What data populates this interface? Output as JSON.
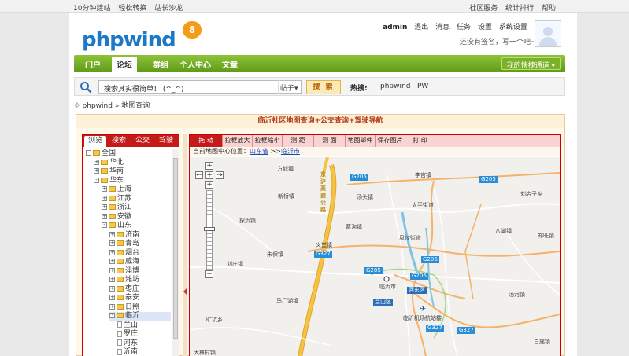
{
  "topbar": {
    "left_links": [
      "10分钟建站",
      "轻松转换",
      "站长沙龙"
    ],
    "right_links": [
      "社区服务",
      "统计排行",
      "帮助"
    ]
  },
  "logo": {
    "part1": "php",
    "part2": "wind",
    "version": "8"
  },
  "user": {
    "name": "admin",
    "links": [
      "退出",
      "消息",
      "任务",
      "设置",
      "系统设置"
    ],
    "signature": "还没有签名，写一个吧~"
  },
  "nav": {
    "items": [
      "门户",
      "论坛",
      "群组",
      "个人中心",
      "文章"
    ],
    "active_index": 1,
    "quick": "我的快捷通道"
  },
  "search": {
    "value": "搜索其实很简单！ (^_^)",
    "scope": "帖子",
    "button": "搜 索",
    "hot_label": "热搜:",
    "hot_words": [
      "phpwind",
      "PW"
    ]
  },
  "breadcrumb": {
    "home": "phpwind",
    "sep": "»",
    "current": "地图查询"
  },
  "map_module": {
    "title": "临沂社区地图查询+公交查询+驾驶导航",
    "left_tabs": [
      "浏览",
      "搜索",
      "公交",
      "驾驶"
    ],
    "active_tab": 0,
    "tree": [
      {
        "label": "全国",
        "level": 0,
        "toggle": "-"
      },
      {
        "label": "华北",
        "level": 1,
        "toggle": "+"
      },
      {
        "label": "华南",
        "level": 1,
        "toggle": "+"
      },
      {
        "label": "华东",
        "level": 1,
        "toggle": "-"
      },
      {
        "label": "上海",
        "level": 2,
        "toggle": "+"
      },
      {
        "label": "江苏",
        "level": 2,
        "toggle": "+"
      },
      {
        "label": "浙江",
        "level": 2,
        "toggle": "+"
      },
      {
        "label": "安徽",
        "level": 2,
        "toggle": "+"
      },
      {
        "label": "山东",
        "level": 2,
        "toggle": "-"
      },
      {
        "label": "济南",
        "level": 3,
        "toggle": "+"
      },
      {
        "label": "青岛",
        "level": 3,
        "toggle": "+"
      },
      {
        "label": "烟台",
        "level": 3,
        "toggle": "+"
      },
      {
        "label": "威海",
        "level": 3,
        "toggle": "+"
      },
      {
        "label": "淄博",
        "level": 3,
        "toggle": "+"
      },
      {
        "label": "潍坊",
        "level": 3,
        "toggle": "+"
      },
      {
        "label": "枣庄",
        "level": 3,
        "toggle": "+"
      },
      {
        "label": "泰安",
        "level": 3,
        "toggle": "+"
      },
      {
        "label": "日照",
        "level": 3,
        "toggle": "+"
      },
      {
        "label": "临沂",
        "level": 3,
        "toggle": "-",
        "selected": true
      },
      {
        "label": "兰山",
        "level": 4,
        "toggle": ""
      },
      {
        "label": "罗庄",
        "level": 4,
        "toggle": ""
      },
      {
        "label": "河东",
        "level": 4,
        "toggle": ""
      },
      {
        "label": "沂南",
        "level": 4,
        "toggle": ""
      }
    ],
    "tools": [
      "拖 动",
      "拉框放大",
      "拉框缩小",
      "测 距",
      "测 面",
      "地图邮件",
      "保存图片",
      "打 印"
    ],
    "active_tool": 0,
    "location_label": "当前地图中心位置：",
    "location_province": "山东省",
    "location_sep": ">>",
    "location_city": "临沂市",
    "zoom_level_fraction": 0.52,
    "map_labels": [
      "方城镇",
      "新桥镇",
      "探沂镇",
      "刘庄镇",
      "朱保镇",
      "义堂镇",
      "临沂市",
      "兰山区",
      "河东区",
      "马厂湖镇",
      "旷坑乡",
      "临沂机场航站楼",
      "大林村镇",
      "李官镇",
      "汤头镇",
      "葛沟镇",
      "凤仪街道",
      "太平街道",
      "刘店子乡",
      "八湖镇",
      "郑旺镇",
      "汤河镇",
      "白旄镇",
      "京沪高速公路"
    ],
    "road_tags": [
      "G205",
      "G205",
      "G327",
      "G206",
      "G205",
      "G206",
      "G327",
      "G327"
    ]
  },
  "colors": {
    "nav_green": "#6aa61f",
    "tab_red": "#c41a1a",
    "title_text": "#b33a1a",
    "link_blue": "#1a4fb5",
    "road_yellow": "#f5c242"
  }
}
